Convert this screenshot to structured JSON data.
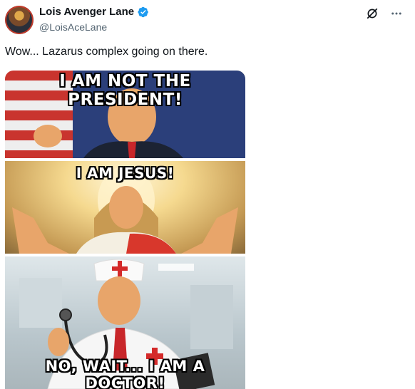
{
  "author": {
    "display_name": "Lois Avenger Lane",
    "handle": "@LoisAceLane",
    "verified": true,
    "avatar_icon": "avatar-image"
  },
  "actions": {
    "grok_icon": "grok-icon",
    "more_icon": "more-horizontal-icon"
  },
  "tweet": {
    "text": "Wow... Lazarus complex going on there."
  },
  "media": {
    "captions": [
      "I AM NOT THE PRESIDENT!",
      "I AM JESUS!",
      "NO, WAIT... I AM A DOCTOR!"
    ]
  },
  "colors": {
    "verified_blue": "#1d9bf0",
    "handle_gray": "#536471"
  }
}
